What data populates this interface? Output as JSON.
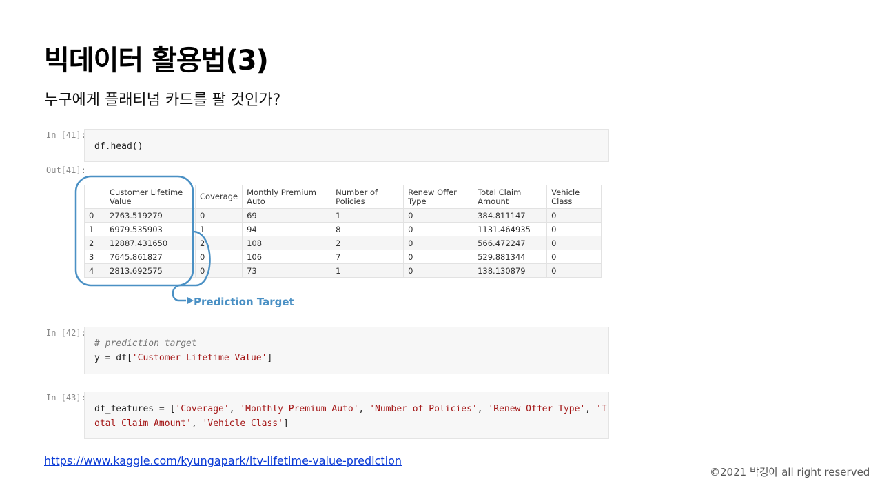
{
  "slide": {
    "title": "빅데이터 활용법(3)",
    "subtitle": "누구에게 플래티넘 카드를 팔 것인가?",
    "link": "https://www.kaggle.com/kyungapark/ltv-lifetime-value-prediction",
    "copyright": "©2021 박경아 all right reserved"
  },
  "cells": {
    "c1": {
      "prompt_in": "In [41]:",
      "code": "df.head()",
      "prompt_out": "Out[41]:"
    },
    "c2": {
      "prompt_in": "In [42]:",
      "comment": "# prediction target",
      "code_pre": "y ",
      "eq": "=",
      "code_mid": " df[",
      "str": "'Customer Lifetime Value'",
      "code_post": "]"
    },
    "c3": {
      "prompt_in": "In [43]:",
      "line1_pre": "df_features ",
      "eq": "=",
      "line1_bracket": " [",
      "s1": "'Coverage'",
      "sep": ", ",
      "s2": "'Monthly Premium Auto'",
      "s3": "'Number of Policies'",
      "s4": "'Renew Offer Type'",
      "s5a": "'T",
      "s5b": "otal Claim Amount'",
      "s6": "'Vehicle Class'",
      "close": "]"
    }
  },
  "table": {
    "headers": [
      "",
      "Customer Lifetime Value",
      "Coverage",
      "Monthly Premium Auto",
      "Number of Policies",
      "Renew Offer Type",
      "Total Claim Amount",
      "Vehicle Class"
    ],
    "rows": [
      [
        "0",
        "2763.519279",
        "0",
        "69",
        "1",
        "0",
        "384.811147",
        "0"
      ],
      [
        "1",
        "6979.535903",
        "1",
        "94",
        "8",
        "0",
        "1131.464935",
        "0"
      ],
      [
        "2",
        "12887.431650",
        "2",
        "108",
        "2",
        "0",
        "566.472247",
        "0"
      ],
      [
        "3",
        "7645.861827",
        "0",
        "106",
        "7",
        "0",
        "529.881344",
        "0"
      ],
      [
        "4",
        "2813.692575",
        "0",
        "73",
        "1",
        "0",
        "138.130879",
        "0"
      ]
    ]
  },
  "annotation": {
    "label": "Prediction Target",
    "color": "#4a90c4"
  }
}
